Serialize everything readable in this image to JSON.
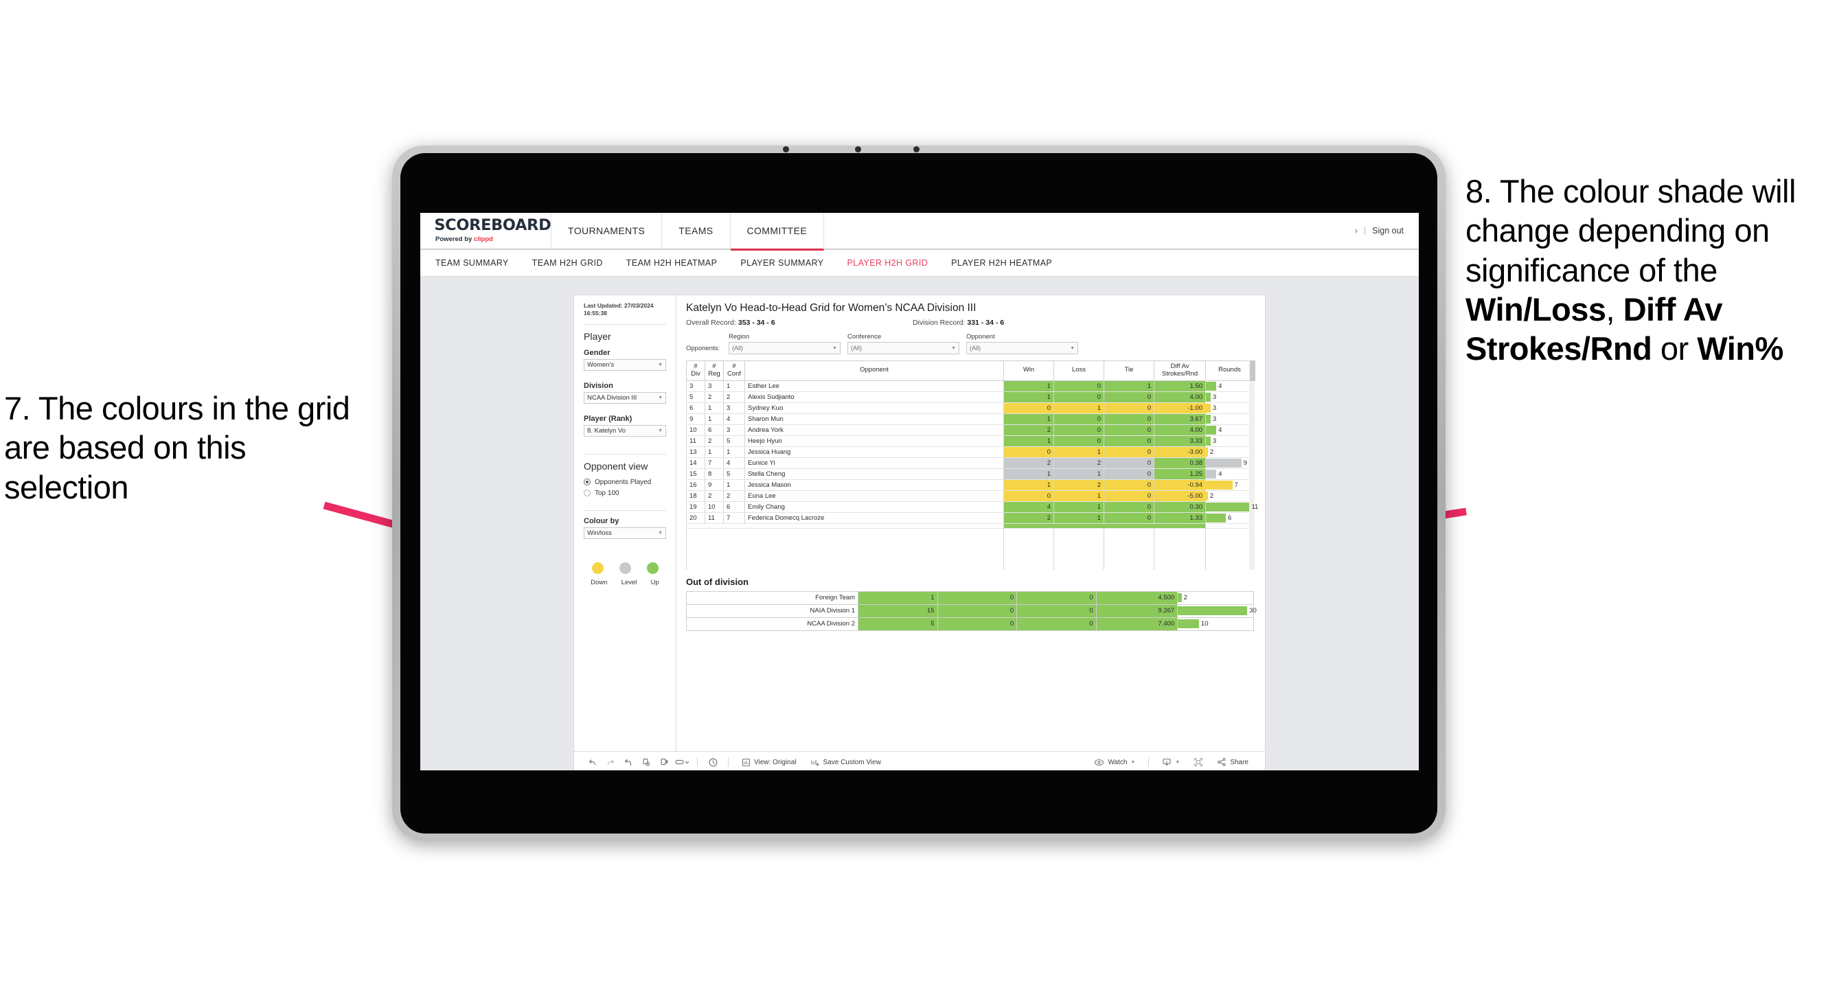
{
  "annotations": {
    "left": {
      "id": "7",
      "text": "7. The colours in the grid are based on this selection"
    },
    "right": {
      "id": "8",
      "line1": "8. The colour shade will change depending on significance of the ",
      "bold1": "Win/Loss",
      "mid1": ", ",
      "bold2": "Diff Av Strokes/Rnd",
      "mid2": " or ",
      "bold3": "Win%"
    },
    "arrow_color": "#ec2b63"
  },
  "app": {
    "logo": {
      "main": "SCOREBOARD",
      "powered_prefix": "Powered by ",
      "brand": "clippd"
    },
    "topnav": [
      {
        "label": "TOURNAMENTS",
        "active": false
      },
      {
        "label": "TEAMS",
        "active": false
      },
      {
        "label": "COMMITTEE",
        "active": true
      }
    ],
    "header_right": {
      "chevron": "›",
      "divider": "|",
      "signout": "Sign out"
    },
    "subnav": [
      {
        "label": "TEAM SUMMARY",
        "active": false
      },
      {
        "label": "TEAM H2H GRID",
        "active": false
      },
      {
        "label": "TEAM H2H HEATMAP",
        "active": false
      },
      {
        "label": "PLAYER SUMMARY",
        "active": false
      },
      {
        "label": "PLAYER H2H GRID",
        "active": true
      },
      {
        "label": "PLAYER H2H HEATMAP",
        "active": false
      }
    ]
  },
  "filters": {
    "last_updated": "Last Updated: 27/03/2024 16:55:38",
    "section_player": "Player",
    "gender": {
      "label": "Gender",
      "value": "Women’s"
    },
    "division": {
      "label": "Division",
      "value": "NCAA Division III"
    },
    "player_rank": {
      "label": "Player (Rank)",
      "value": "8. Katelyn Vo"
    },
    "opponent_view": {
      "label": "Opponent view",
      "options": [
        {
          "label": "Opponents Played",
          "selected": true
        },
        {
          "label": "Top 100",
          "selected": false
        }
      ]
    },
    "colour_by": {
      "label": "Colour by",
      "value": "Win/loss"
    },
    "legend": [
      {
        "label": "Down",
        "color": "#f5d547"
      },
      {
        "label": "Level",
        "color": "#c7cacc"
      },
      {
        "label": "Up",
        "color": "#8bc95a"
      }
    ]
  },
  "viz": {
    "title": "Katelyn Vo Head-to-Head Grid for Women’s NCAA Division III",
    "overall_record_label": "Overall Record: ",
    "overall_record_value": "353 -  34 - 6",
    "division_record_label": "Division Record: ",
    "division_record_value": "331 -  34 - 6",
    "opponents_label": "Opponents:",
    "opponent_filters": [
      {
        "label": "Region",
        "value": "(All)"
      },
      {
        "label": "Conference",
        "value": "(All)"
      },
      {
        "label": "Opponent",
        "value": "(All)"
      }
    ],
    "columns": [
      {
        "l1": "#",
        "l2": "Div"
      },
      {
        "l1": "#",
        "l2": "Reg"
      },
      {
        "l1": "#",
        "l2": "Conf"
      },
      {
        "l1": "Opponent",
        "l2": ""
      },
      {
        "l1": "Win",
        "l2": ""
      },
      {
        "l1": "Loss",
        "l2": ""
      },
      {
        "l1": "Tie",
        "l2": ""
      },
      {
        "l1": "Diff Av",
        "l2": "Strokes/Rnd"
      },
      {
        "l1": "Rounds",
        "l2": ""
      }
    ],
    "rows": [
      {
        "div": "3",
        "reg": "3",
        "conf": "1",
        "opponent": "Esther Lee",
        "win": "1",
        "loss": "0",
        "tie": "1",
        "diff": "1.50",
        "rounds": "4",
        "color": "#8bc95a",
        "bar_pct": 22
      },
      {
        "div": "5",
        "reg": "2",
        "conf": "2",
        "opponent": "Alexis Sudjianto",
        "win": "1",
        "loss": "0",
        "tie": "0",
        "diff": "4.00",
        "rounds": "3",
        "color": "#8bc95a",
        "bar_pct": 10
      },
      {
        "div": "6",
        "reg": "1",
        "conf": "3",
        "opponent": "Sydney Kuo",
        "win": "0",
        "loss": "1",
        "tie": "0",
        "diff": "-1.00",
        "rounds": "3",
        "color": "#f5d547",
        "bar_pct": 10
      },
      {
        "div": "9",
        "reg": "1",
        "conf": "4",
        "opponent": "Sharon Mun",
        "win": "1",
        "loss": "0",
        "tie": "0",
        "diff": "3.67",
        "rounds": "3",
        "color": "#8bc95a",
        "bar_pct": 10
      },
      {
        "div": "10",
        "reg": "6",
        "conf": "3",
        "opponent": "Andrea York",
        "win": "2",
        "loss": "0",
        "tie": "0",
        "diff": "4.00",
        "rounds": "4",
        "color": "#8bc95a",
        "bar_pct": 22
      },
      {
        "div": "11",
        "reg": "2",
        "conf": "5",
        "opponent": "Heejo Hyun",
        "win": "1",
        "loss": "0",
        "tie": "0",
        "diff": "3.33",
        "rounds": "3",
        "color": "#8bc95a",
        "bar_pct": 10
      },
      {
        "div": "13",
        "reg": "1",
        "conf": "1",
        "opponent": "Jessica Huang",
        "win": "0",
        "loss": "1",
        "tie": "0",
        "diff": "-3.00",
        "rounds": "2",
        "color": "#f5d547",
        "bar_pct": 4
      },
      {
        "div": "14",
        "reg": "7",
        "conf": "4",
        "opponent": "Eunice Yi",
        "win": "2",
        "loss": "2",
        "tie": "0",
        "diff": "0.38",
        "rounds": "9",
        "color": "#c7cacc",
        "diff_color": "#8bc95a",
        "bar_pct": 75
      },
      {
        "div": "15",
        "reg": "8",
        "conf": "5",
        "opponent": "Stella Cheng",
        "win": "1",
        "loss": "1",
        "tie": "0",
        "diff": "1.25",
        "rounds": "4",
        "color": "#c7cacc",
        "diff_color": "#8bc95a",
        "bar_pct": 22
      },
      {
        "div": "16",
        "reg": "9",
        "conf": "1",
        "opponent": "Jessica Mason",
        "win": "1",
        "loss": "2",
        "tie": "0",
        "diff": "-0.94",
        "rounds": "7",
        "color": "#f5d547",
        "bar_pct": 56
      },
      {
        "div": "18",
        "reg": "2",
        "conf": "2",
        "opponent": "Euna Lee",
        "win": "0",
        "loss": "1",
        "tie": "0",
        "diff": "-5.00",
        "rounds": "2",
        "color": "#f5d547",
        "bar_pct": 4
      },
      {
        "div": "19",
        "reg": "10",
        "conf": "6",
        "opponent": "Emily Chang",
        "win": "4",
        "loss": "1",
        "tie": "0",
        "diff": "0.30",
        "rounds": "11",
        "color": "#8bc95a",
        "bar_pct": 92
      },
      {
        "div": "20",
        "reg": "11",
        "conf": "7",
        "opponent": "Federica Domecq Lacroze",
        "win": "2",
        "loss": "1",
        "tie": "0",
        "diff": "1.33",
        "rounds": "6",
        "color": "#8bc95a",
        "bar_pct": 42
      }
    ],
    "out_of_division": {
      "title": "Out of division",
      "rows": [
        {
          "name": "Foreign Team",
          "win": "1",
          "loss": "0",
          "tie": "0",
          "diff": "4.500",
          "rounds": "2",
          "color": "#8bc95a",
          "bar_pct": 5
        },
        {
          "name": "NAIA Division 1",
          "win": "15",
          "loss": "0",
          "tie": "0",
          "diff": "9.267",
          "rounds": "30",
          "color": "#8bc95a",
          "bar_pct": 92
        },
        {
          "name": "NCAA Division 2",
          "win": "5",
          "loss": "0",
          "tie": "0",
          "diff": "7.400",
          "rounds": "10",
          "color": "#8bc95a",
          "bar_pct": 28
        }
      ]
    }
  },
  "toolbar": {
    "icons": [
      "undo-icon",
      "redo-icon",
      "revert-icon",
      "refresh-icon",
      "pause-icon",
      "filter-icon"
    ],
    "view_label": "View: Original",
    "save_view_label": "Save Custom View",
    "watch_label": "Watch",
    "share_label": "Share"
  }
}
